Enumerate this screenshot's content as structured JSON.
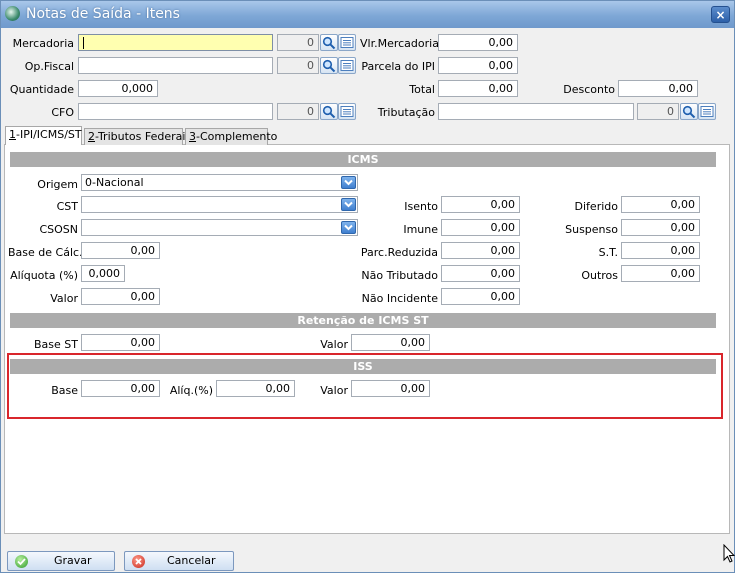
{
  "window": {
    "title": "Notas de Saída - Itens",
    "close_glyph": "×"
  },
  "header": {
    "mercadoria": {
      "label": "Mercadoria",
      "value": "",
      "code": "0"
    },
    "op_fiscal": {
      "label": "Op.Fiscal",
      "value": "",
      "code": "0"
    },
    "quantidade": {
      "label": "Quantidade",
      "value": "0,000"
    },
    "cfo": {
      "label": "CFO",
      "value": "",
      "code": "0"
    },
    "vlr_mercadorias": {
      "label": "Vlr.Mercadorias",
      "value": "0,00"
    },
    "parcela_ipi": {
      "label": "Parcela do IPI",
      "value": "0,00"
    },
    "total": {
      "label": "Total",
      "value": "0,00"
    },
    "desconto": {
      "label": "Desconto",
      "value": "0,00"
    },
    "tributacao": {
      "label": "Tributação",
      "value": "",
      "code": "0"
    }
  },
  "tabs": [
    {
      "key": "1",
      "label": "-IPI/ICMS/ST",
      "active": true
    },
    {
      "key": "2",
      "label": "-Tributos Federais",
      "active": false
    },
    {
      "key": "3",
      "label": "-Complemento",
      "active": false
    }
  ],
  "icms": {
    "title": "ICMS",
    "origem": {
      "label": "Origem",
      "value": "0-Nacional"
    },
    "cst": {
      "label": "CST",
      "value": ""
    },
    "csosn": {
      "label": "CSOSN",
      "value": ""
    },
    "base_calc": {
      "label": "Base de Cálc.",
      "value": "0,00"
    },
    "aliquota": {
      "label": "Alíquota (%)",
      "value": "0,000"
    },
    "valor": {
      "label": "Valor",
      "value": "0,00"
    },
    "isento": {
      "label": "Isento",
      "value": "0,00"
    },
    "imune": {
      "label": "Imune",
      "value": "0,00"
    },
    "parc_reduzida": {
      "label": "Parc.Reduzida",
      "value": "0,00"
    },
    "nao_tributado": {
      "label": "Não Tributado",
      "value": "0,00"
    },
    "nao_incidente": {
      "label": "Não Incidente",
      "value": "0,00"
    },
    "diferido": {
      "label": "Diferido",
      "value": "0,00"
    },
    "suspenso": {
      "label": "Suspenso",
      "value": "0,00"
    },
    "st": {
      "label": "S.T.",
      "value": "0,00"
    },
    "outros": {
      "label": "Outros",
      "value": "0,00"
    }
  },
  "retencao": {
    "title": "Retenção de ICMS ST",
    "base_st": {
      "label": "Base ST",
      "value": "0,00"
    },
    "valor": {
      "label": "Valor",
      "value": "0,00"
    }
  },
  "iss": {
    "title": "ISS",
    "base": {
      "label": "Base",
      "value": "0,00"
    },
    "aliq": {
      "label": "Alíq.(%)",
      "value": "0,00"
    },
    "valor": {
      "label": "Valor",
      "value": "0,00"
    }
  },
  "footer": {
    "gravar": "Gravar",
    "cancelar": "Cancelar"
  },
  "colors": {
    "highlight": "#d9262c",
    "section": "#acacac",
    "titlebar": "#7ea7d6"
  }
}
